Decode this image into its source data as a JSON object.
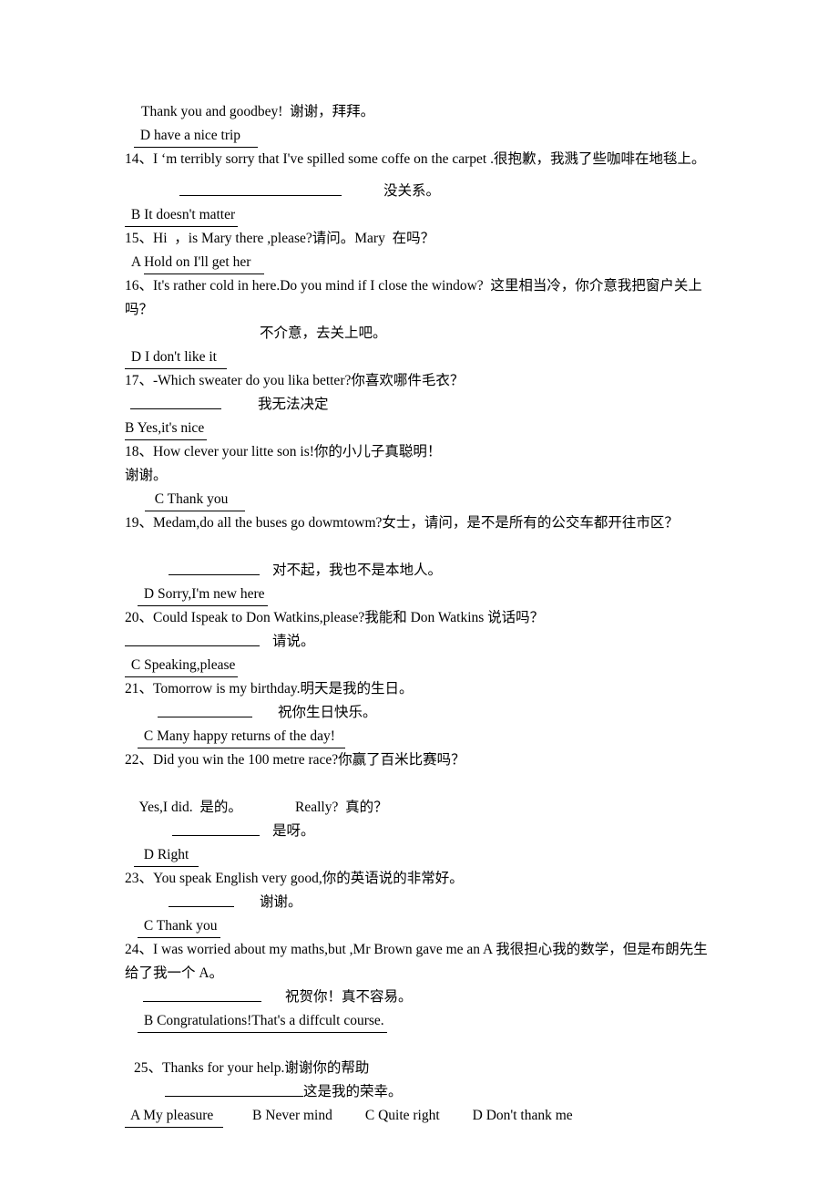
{
  "document": {
    "type": "english-chinese-dialogue-exercise-answer-key",
    "intro": {
      "line": "Thank you and goodbey!  谢谢，拜拜。",
      "answer": " D have a nice trip    "
    },
    "items": [
      {
        "number": "14、",
        "prompt": "I ‘m terribly sorry that I've spilled some coffe on the carpet .很抱歉，我溅了些咖啡在地毯上。",
        "reply": "没关系。",
        "blank_width": 178,
        "blank_indent": 60,
        "reply_gap": 46,
        "answer": " B It doesn't matter",
        "blank_on_own_line": true,
        "extra_space_before_blank": true
      },
      {
        "number": "15、",
        "prompt": "Hi  ，is Mary there ,please?请问。Mary  在吗？",
        "reply": "",
        "answer": "  A Hold on I'll get her   ",
        "answer_split": {
          "prefix": "  A ",
          "underlined": "Hold on I'll get her   "
        },
        "blank_on_own_line": false
      },
      {
        "number": "16、",
        "prompt": "It's rather cold in here.Do you mind if I close the window?  这里相当冷，你介意我把窗户关上吗？",
        "reply": "不介意，去关上吧。",
        "reply_indent": 148,
        "answer": " D I don't like it  ",
        "blank_on_own_line": false
      },
      {
        "number": "17、",
        "prompt": "-Which sweater do you lika better?你喜欢哪件毛衣？",
        "reply": "我无法决定",
        "blank_width": 100,
        "blank_indent": 6,
        "reply_gap": 40,
        "answer": "B Yes,it's nice",
        "blank_on_own_line": true
      },
      {
        "number": "18、",
        "prompt": "How clever your litte son is!你的小儿子真聪明！",
        "reply": "谢谢。",
        "reply_indent": 0,
        "answer": "  C Thank you    ",
        "blank_on_own_line": false
      },
      {
        "number": "19、",
        "prompt": "Medam,do all the buses go dowmtowm?女士，请问，是不是所有的公交车都开往市区？",
        "reply": "对不起，我也不是本地人。",
        "blank_width": 100,
        "blank_indent": 48,
        "reply_gap": 14,
        "answer": " D Sorry,I'm new here",
        "blank_on_own_line": true,
        "extra_space_before_blank": true
      },
      {
        "number": "20、",
        "prompt": "Could Ispeak to Don Watkins,please?我能和 Don Watkins 说话吗？",
        "reply": "请说。",
        "blank_width": 148,
        "blank_indent": 0,
        "reply_gap": 14,
        "answer": " C Speaking,please",
        "blank_on_own_line": true
      },
      {
        "number": "21、",
        "prompt": "Tomorrow is my birthday.明天是我的生日。",
        "reply": "祝你生日快乐。",
        "blank_width": 104,
        "blank_indent": 36,
        "reply_gap": 28,
        "answer": " C Many happy returns of the day!  ",
        "blank_on_own_line": true
      },
      {
        "number": "22、",
        "prompt": "Did you win the 100 metre race?你赢了百米比赛吗？",
        "dialogue": "    Yes,I did.  是的。               Really?  真的？",
        "reply": "是呀。",
        "blank_width": 96,
        "blank_indent": 52,
        "reply_gap": 14,
        "answer": "  D Right  ",
        "blank_on_own_line": true,
        "extra_space_before_dialogue": true
      },
      {
        "number": "23、",
        "prompt": "You speak English very good,你的英语说的非常好。",
        "reply": "谢谢。",
        "blank_width": 72,
        "blank_indent": 48,
        "reply_gap": 28,
        "answer": " C Thank you",
        "blank_on_own_line": true
      },
      {
        "number": "24、",
        "prompt": "I was worried about my maths,but ,Mr Brown gave me an A 我很担心我的数学，但是布朗先生给了我一个 A。",
        "reply": "祝贺你！真不容易。",
        "blank_width": 130,
        "blank_indent": 20,
        "reply_gap": 26,
        "answer": " B Congratulations!That's a diffcult course.",
        "blank_on_own_line": true
      },
      {
        "number": "25、",
        "prompt": "Thanks for your help.谢谢你的帮助",
        "reply": "这是我的荣幸。",
        "blank_width": 152,
        "blank_indent": 44,
        "reply_gap": 0,
        "blank_on_own_line": true,
        "extra_space_before_item": true,
        "options": [
          {
            "label": " A My pleasure  ",
            "underlined": true
          },
          {
            "label": "B Never mind",
            "underlined": false
          },
          {
            "label": "C Quite right",
            "underlined": false
          },
          {
            "label": "D Don't thank me",
            "underlined": false
          }
        ]
      }
    ]
  }
}
